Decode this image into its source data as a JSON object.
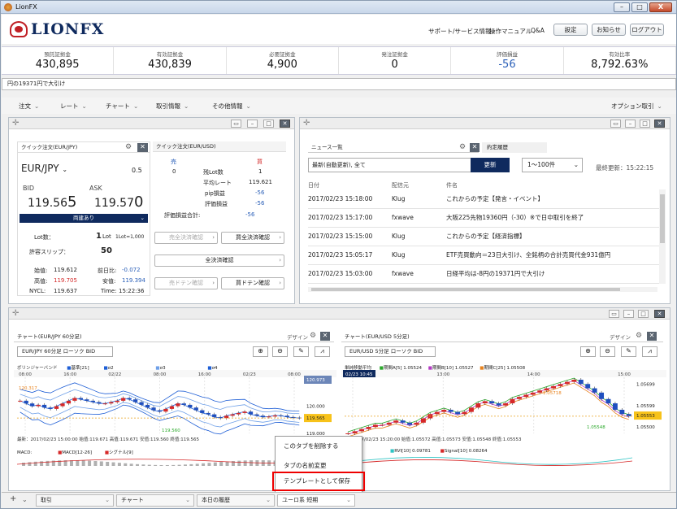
{
  "window": {
    "title": "LionFX",
    "min": "–",
    "max": "□",
    "close": "X"
  },
  "brand": {
    "logo_text": "LIONFX",
    "color": "#0f2a5e",
    "accent": "#c01f25"
  },
  "header": {
    "links": [
      "サポート/サービス情報",
      "操作マニュアル",
      "Q&A"
    ],
    "buttons": [
      "設定",
      "お知らせ",
      "ログアウト"
    ]
  },
  "summary": [
    {
      "label": "預託証拠金",
      "value": "430,895"
    },
    {
      "label": "有効証拠金",
      "value": "430,839"
    },
    {
      "label": "必要証拠金",
      "value": "4,900"
    },
    {
      "label": "発注証拠金",
      "value": "0"
    },
    {
      "label": "評価損益",
      "value": "-56"
    },
    {
      "label": "有効比率",
      "value": "8,792.63%"
    }
  ],
  "ticker": {
    "text": "円の19371円で大引け"
  },
  "menubar": {
    "items": [
      "注文",
      "レート",
      "チャート",
      "取引情報",
      "その他情報"
    ],
    "right": "オプション取引"
  },
  "quick_order": {
    "tab1": "クイック注文(EUR/JPY)",
    "tab2": "クイック注文(EUR/USD)",
    "pair": "EUR/JPY",
    "spread": "0.5",
    "bid_label": "BID",
    "ask_label": "ASK",
    "bid_main": "119.56",
    "bid_pip": "5",
    "ask_main": "119.57",
    "ask_pip": "0",
    "both_label": "両建あり",
    "lot_label": "Lot数：",
    "lot_value": "1",
    "lot_unit": "Lot",
    "lot_note": "1Lot=1,000",
    "slip_label": "許容スリップ：",
    "slip_value": "50",
    "open_label": "始值:",
    "open_value": "119.612",
    "change_label": "前日比:",
    "change_value": "-0.072",
    "high_label": "高值:",
    "high_value": "119.705",
    "low_label": "安值:",
    "low_value": "119.394",
    "nycl_label": "NYCL:",
    "nycl_value": "119.637",
    "time_label": "Time:",
    "time_value": "15:22:36",
    "sell_label": "売",
    "buy_label": "買",
    "sell_count": "0",
    "buy_count": "1",
    "remain_label": "残Lot数",
    "avg_label": "平均レート",
    "avg_value": "119.621",
    "pip_label": "pip損益",
    "pip_value": "-56",
    "eval_label": "評価損益",
    "eval_value": "-56",
    "total_label": "評価損益合計:",
    "total_value": "-56",
    "btn_sell_all": "売全決済確認",
    "btn_buy_all": "買全決済確認",
    "btn_all": "全決済確認",
    "btn_sell_ten": "売ドテン確認",
    "btn_buy_ten": "買ドテン確認"
  },
  "news": {
    "tab1": "ニュース一覧",
    "tab2": "約定履歴",
    "filter": "最新(自動更新), 全て",
    "refresh": "更新",
    "range": "1～100件",
    "updated": "最終更新：15:22:15",
    "columns": [
      "日付",
      "配信元",
      "件名"
    ],
    "rows": [
      {
        "date": "2017/02/23 15:18:00",
        "src": "Klug",
        "title": "これからの予定【発言・イベント】"
      },
      {
        "date": "2017/02/23 15:17:00",
        "src": "fxwave",
        "title": "大阪225先物19360円（-30）※で日中取引を終了"
      },
      {
        "date": "2017/02/23 15:15:00",
        "src": "Klug",
        "title": "これからの予定【経済指標】"
      },
      {
        "date": "2017/02/23 15:05:17",
        "src": "Klug",
        "title": "ETF売買動向＝23日大引け、全銘柄の合計売買代金931億円"
      },
      {
        "date": "2017/02/23 15:03:00",
        "src": "fxwave",
        "title": "日経平均は-8円の19371円で大引け"
      }
    ]
  },
  "chart1": {
    "tab": "チャート(EUR/JPY 60分足)",
    "design": "デザイン",
    "symbol": "EUR/JPY 60分足 ローソク BID",
    "ind_label": "ボリンジャーバンド",
    "legend": [
      {
        "name": "基準[21]",
        "color": "#1f5fd6"
      },
      {
        "name": "σ2",
        "color": "#1f5fd6"
      },
      {
        "name": "σ3",
        "color": "#6fa0e8"
      },
      {
        "name": "σ4",
        "color": "#1f5fd6"
      }
    ],
    "times": [
      "08:00",
      "16:00",
      "02/22",
      "08:00",
      "16:00",
      "02/23",
      "08:00"
    ],
    "yaxis": [
      "120.973",
      "120.000",
      "119.565",
      "119.000"
    ],
    "hi_label": "120.317",
    "lo_label": "119.560",
    "ohlc": "最新：2017/02/23 15:00:00 始值:119.671 高值:119.671 安值:119.560 終值:119.565",
    "macd_label": "MACD:",
    "macd_legend": "MACD[12-26]",
    "signal_legend": "シグナル[9]"
  },
  "chart2": {
    "tab": "チャート(EUR/USD 5分足)",
    "design": "デザイン",
    "symbol": "EUR/USD 5分足 ローソク BID",
    "ind_label": "単純移動平均",
    "legend": [
      {
        "name": "期間A[5] 1.05524",
        "color": "#2aa82a"
      },
      {
        "name": "期間B[10] 1.05527",
        "color": "#b43cc4"
      },
      {
        "name": "期間C[25] 1.05508",
        "color": "#e8831e"
      }
    ],
    "date_tag": "02/23 10:45",
    "times": [
      "12:00",
      "13:00",
      "14:00",
      "15:00"
    ],
    "yaxis": [
      "1.05699",
      "1.05599",
      "1.05553",
      "1.05500"
    ],
    "hi_label": "1.05718",
    "lo_label": "1.05548",
    "ohlc": "+ : 2017/02/23 15:20:00 始值:1.05572 高值:1.05573 安值:1.05548 終值:1.05553",
    "rvi_legend": "RVI[10] 0.09781",
    "sig_legend": "Signal[10] 0.08264"
  },
  "context_menu": {
    "items": [
      "このタブを削除する",
      "タブの名前変更",
      "テンプレートとして保存"
    ]
  },
  "bottom_tabs": [
    "取引",
    "チャート",
    "本日の履歴",
    "ユーロ系 短期"
  ],
  "chart_data": [
    {
      "type": "candlestick",
      "title": "EUR/JPY 60分足",
      "note": "approximate closes",
      "y_ticks": [
        120.973,
        120.0,
        119.565,
        119.0
      ],
      "closes": [
        120.2,
        120.1,
        120.0,
        120.05,
        119.95,
        119.9,
        120.0,
        120.1,
        120.2,
        120.3,
        120.25,
        120.2,
        120.15,
        120.1,
        120.1,
        120.15,
        120.2,
        120.3,
        120.25,
        120.15,
        120.05,
        119.95,
        119.85,
        119.8,
        119.9,
        120.0,
        120.1,
        120.05,
        119.95,
        119.85,
        119.75,
        119.7,
        119.6,
        119.56,
        119.65,
        119.7,
        119.75,
        119.8,
        119.7,
        119.65,
        119.6,
        119.62,
        119.66,
        119.65,
        119.6,
        119.58,
        119.565
      ]
    },
    {
      "type": "candlestick",
      "title": "EUR/USD 5分足",
      "note": "approximate closes",
      "y_ticks": [
        1.05699,
        1.05599,
        1.05553,
        1.055
      ],
      "closes": [
        1.0547,
        1.0548,
        1.0549,
        1.055,
        1.0551,
        1.0551,
        1.0552,
        1.0553,
        1.0552,
        1.0551,
        1.0552,
        1.0554,
        1.0556,
        1.0557,
        1.0558,
        1.0557,
        1.0556,
        1.0557,
        1.0559,
        1.0561,
        1.0562,
        1.0561,
        1.056,
        1.0561,
        1.0563,
        1.0564,
        1.0565,
        1.0566,
        1.0567,
        1.0568,
        1.0569,
        1.057,
        1.0571,
        1.0572,
        1.057,
        1.0568,
        1.0566,
        1.0563,
        1.0561,
        1.0558,
        1.0556,
        1.0555
      ]
    }
  ]
}
